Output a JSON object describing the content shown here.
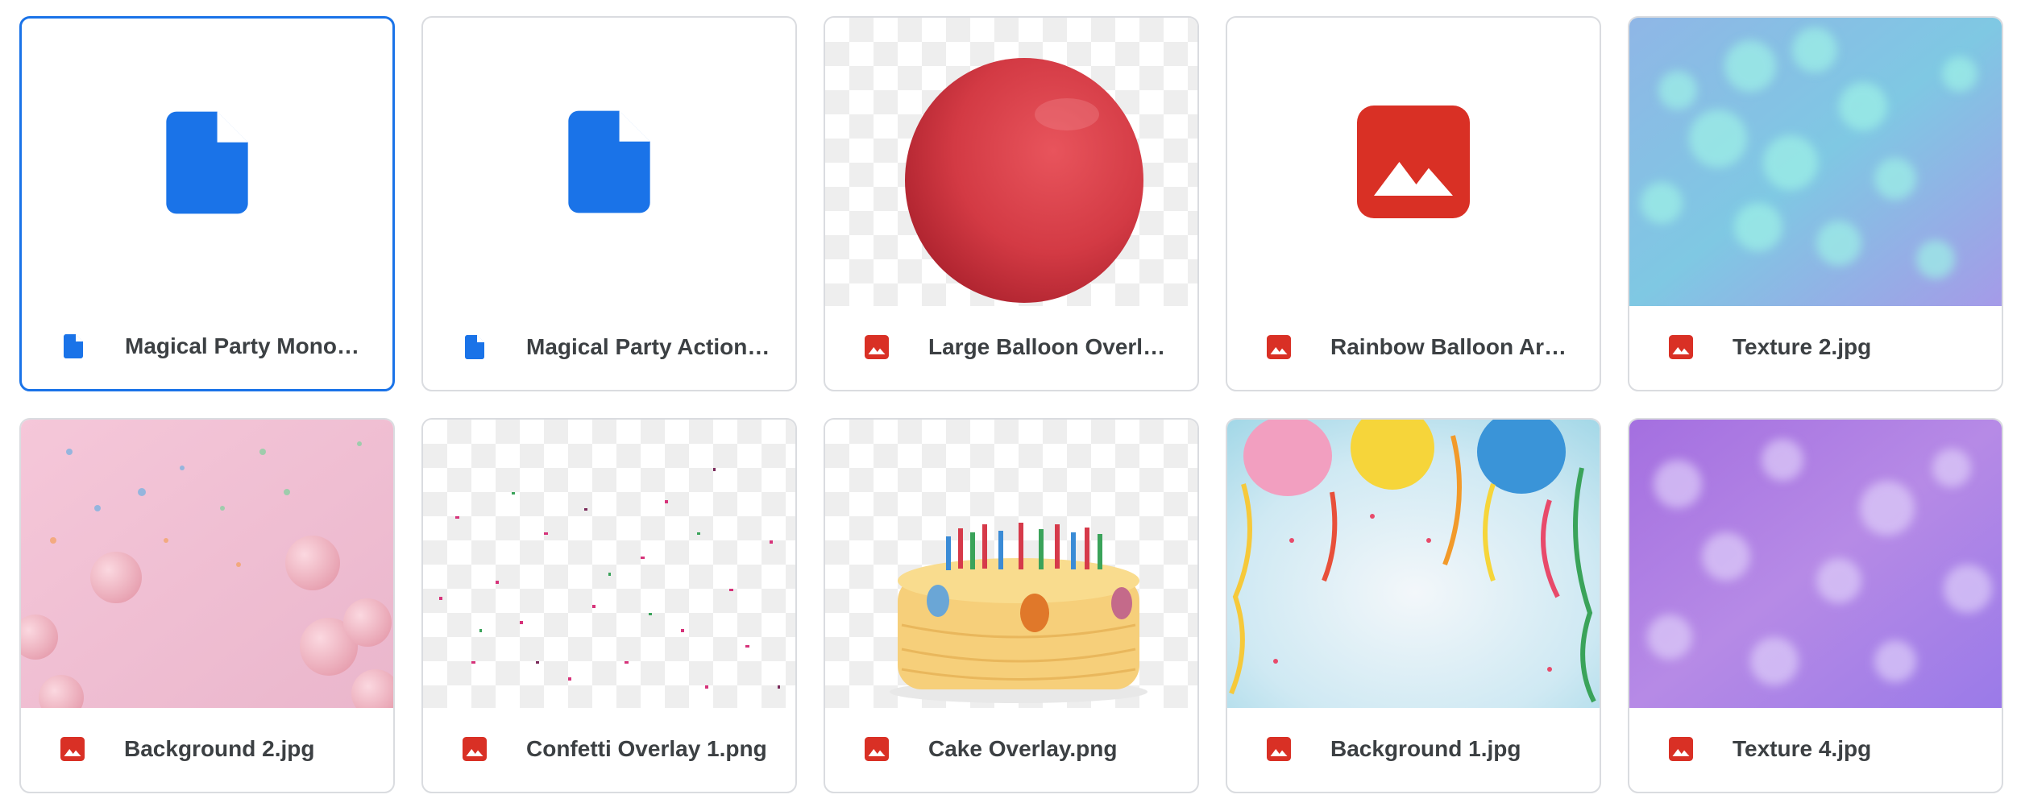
{
  "files": [
    {
      "name": "Magical Party Monochrome Preset.xmp",
      "type": "document",
      "selected": true
    },
    {
      "name": "Magical Party Action.atn",
      "type": "document"
    },
    {
      "name": "Large Balloon Overlay.png",
      "type": "image"
    },
    {
      "name": "Rainbow Balloon Arch Overlay.png",
      "type": "image"
    },
    {
      "name": "Texture 2.jpg",
      "type": "image"
    },
    {
      "name": "Background 2.jpg",
      "type": "image"
    },
    {
      "name": "Confetti Overlay 1.png",
      "type": "image"
    },
    {
      "name": "Cake Overlay.png",
      "type": "image"
    },
    {
      "name": "Background 1.jpg",
      "type": "image"
    },
    {
      "name": "Texture 4.jpg",
      "type": "image"
    }
  ],
  "colors": {
    "doc_blue": "#1a73e8",
    "image_red": "#d93025",
    "selection": "#1a73e8"
  },
  "icons": {
    "document": "document-icon",
    "image": "image-icon"
  }
}
